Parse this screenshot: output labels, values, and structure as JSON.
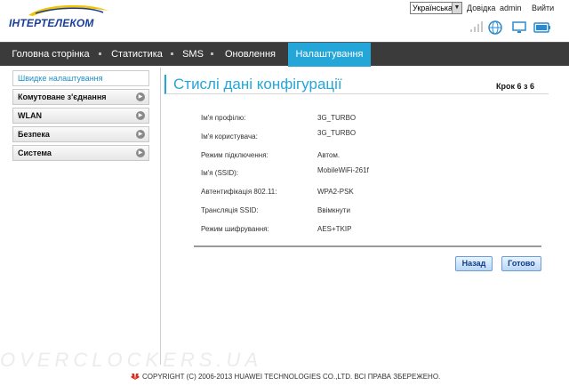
{
  "header": {
    "logo_text": "ІНТЕРТЕЛЕКОМ",
    "language": "Українська",
    "links": {
      "help": "Довідка",
      "user": "admin",
      "logout": "Вийти"
    }
  },
  "nav": {
    "tabs": [
      {
        "label": "Головна сторінка"
      },
      {
        "label": "Статистика"
      },
      {
        "label": "SMS"
      },
      {
        "label": "Оновлення"
      },
      {
        "label": "Налаштування"
      }
    ]
  },
  "sidebar": {
    "items": [
      {
        "label": "Швидке налаштування"
      },
      {
        "label": "Комутоване з'єднання"
      },
      {
        "label": "WLAN"
      },
      {
        "label": "Безпека"
      },
      {
        "label": "Система"
      }
    ]
  },
  "main": {
    "title": "Стислі дані конфігурації",
    "step": "Крок 6 з 6",
    "rows": [
      {
        "label": "Ім'я профілю:",
        "value": "3G_TURBO"
      },
      {
        "label": "Ім'я користувача:",
        "value": "3G_TURBO"
      },
      {
        "label": "Режим підключення:",
        "value": "Автом."
      },
      {
        "label": "Ім'я (SSID):",
        "value": "MobileWiFi-261f"
      },
      {
        "label": "Автентифікація 802.11:",
        "value": "WPA2-PSK"
      },
      {
        "label": "Трансляція SSID:",
        "value": "Ввімкнути"
      },
      {
        "label": "Режим шифрування:",
        "value": "AES+TKIP"
      }
    ],
    "buttons": {
      "back": "Назад",
      "done": "Готово"
    }
  },
  "footer": {
    "copyright": "COPYRIGHT (C) 2006-2013 HUAWEI TECHNOLOGIES CO.,LTD. ВСІ ПРАВА ЗБЕРЕЖЕНО.",
    "watermark": "OVERCLOCKERS.UA"
  },
  "colors": {
    "accent": "#25a6d9",
    "nav_bg": "#3b3b3b",
    "brand": "#1a3e9c"
  },
  "icons": [
    "signal-icon",
    "globe-icon",
    "monitor-icon",
    "battery-icon",
    "logo-swoosh-icon",
    "chevron-right-icon"
  ]
}
